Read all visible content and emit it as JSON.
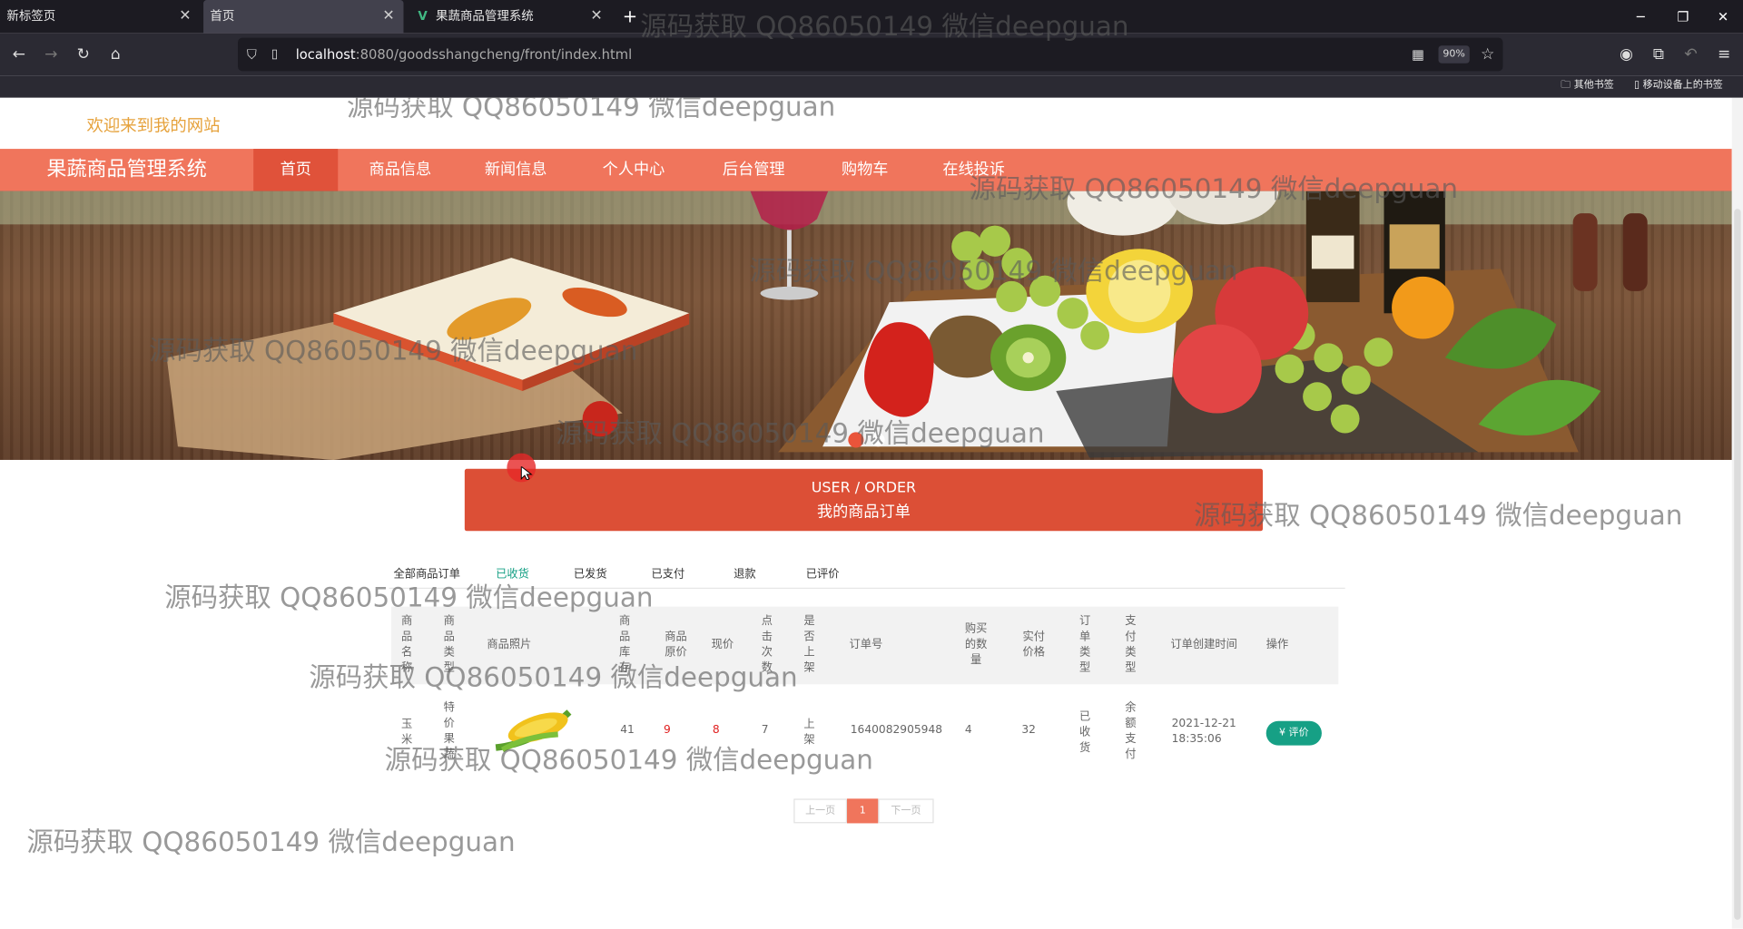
{
  "browser": {
    "tabs": [
      {
        "title": "新标签页"
      },
      {
        "title": "首页"
      },
      {
        "title": "果蔬商品管理系统"
      }
    ],
    "url_host": "localhost",
    "url_rest": ":8080/goodsshangcheng/front/index.html",
    "zoom": "90%",
    "bookmarks": [
      "其他书签",
      "移动设备上的书签"
    ]
  },
  "site": {
    "welcome": "欢迎来到我的网站",
    "brand": "果蔬商品管理系统",
    "nav": [
      "首页",
      "商品信息",
      "新闻信息",
      "个人中心",
      "后台管理",
      "购物车",
      "在线投诉"
    ],
    "active_nav": "首页"
  },
  "order_header": {
    "en": "USER / ORDER",
    "cn": "我的商品订单"
  },
  "subtabs": [
    "全部商品订单",
    "已收货",
    "已发货",
    "已支付",
    "退款",
    "已评价"
  ],
  "active_subtab": "已收货",
  "table": {
    "headers": {
      "name": "商品名称",
      "category": "商品类型",
      "photo": "商品照片",
      "stock": "商品库存",
      "original_price": "商品原价",
      "current_price": "现价",
      "clicks": "点击次数",
      "listed": "是否上架",
      "order_no": "订单号",
      "quantity": "购买的数量",
      "paid": "实付价格",
      "order_type": "订单类型",
      "pay_type": "支付类型",
      "created": "订单创建时间",
      "actions": "操作"
    },
    "rows": [
      {
        "name": "玉米",
        "category": "特价果蔬",
        "stock": "41",
        "original_price": "9",
        "current_price": "8",
        "clicks": "7",
        "listed": "上架",
        "order_no": "1640082905948",
        "quantity": "4",
        "paid": "32",
        "order_type": "已收货",
        "pay_type": "余额支付",
        "created_date": "2021-12-21",
        "created_time": "18:35:06",
        "action": "评价"
      }
    ]
  },
  "pager": {
    "prev": "上一页",
    "current": "1",
    "next": "下一页"
  },
  "watermark": "源码获取 QQ86050149 微信deepguan",
  "colors": {
    "primary": "#f0755c",
    "active": "#e0523a",
    "teal": "#16a085",
    "header": "#dc4f36"
  }
}
